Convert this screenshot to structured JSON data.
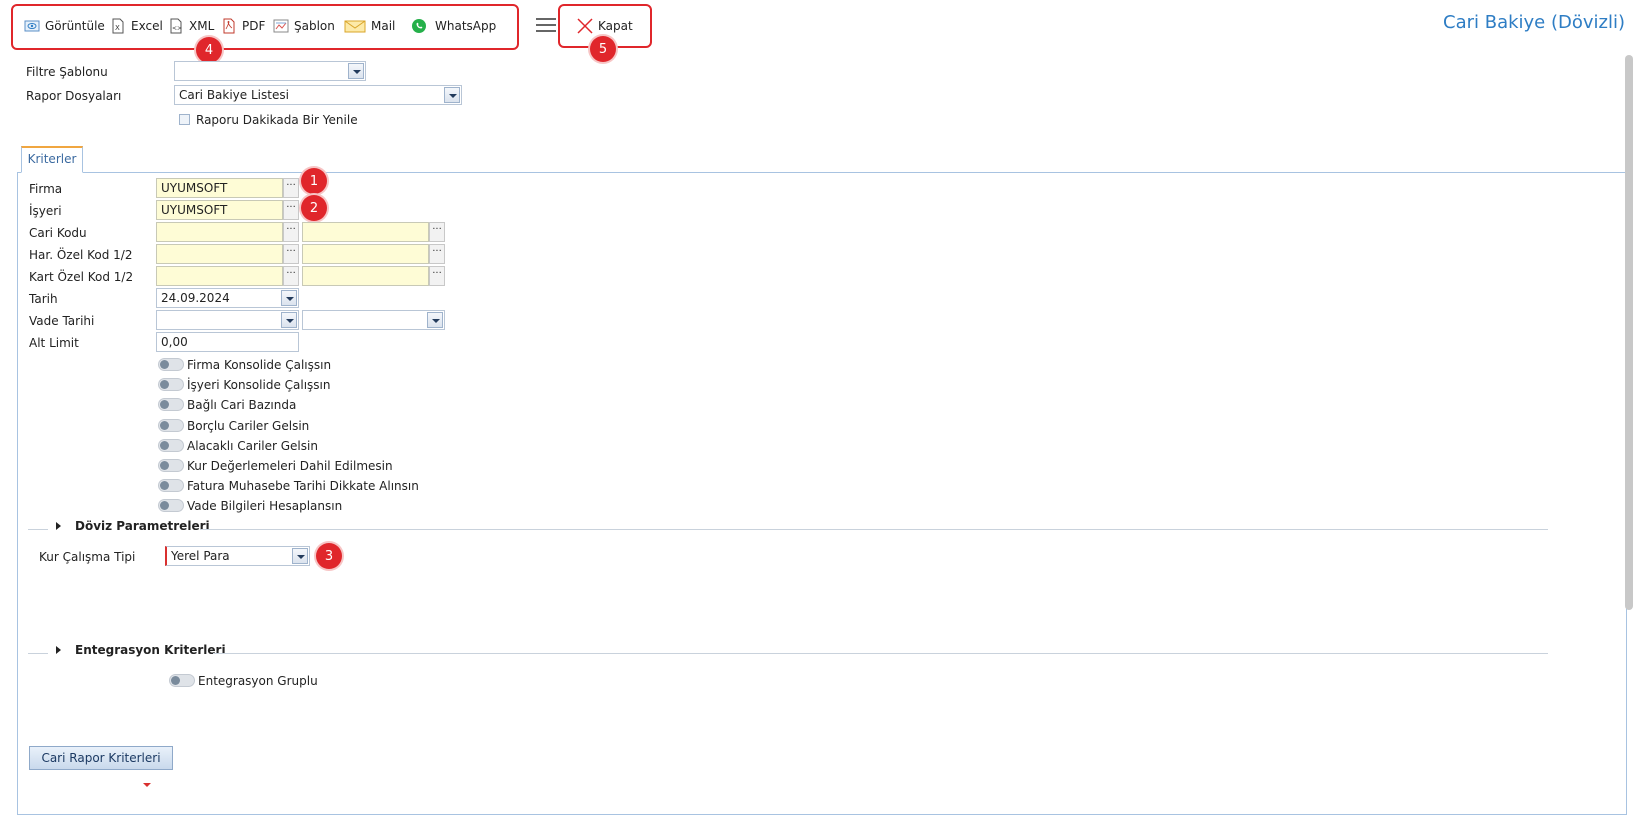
{
  "toolbar": {
    "items": [
      {
        "label": "Görüntüle",
        "icon": "view-icon"
      },
      {
        "label": "Excel",
        "icon": "excel-icon"
      },
      {
        "label": "XML",
        "icon": "xml-icon"
      },
      {
        "label": "PDF",
        "icon": "pdf-icon"
      },
      {
        "label": "Şablon",
        "icon": "template-icon"
      },
      {
        "label": "Mail",
        "icon": "mail-icon"
      },
      {
        "label": "WhatsApp",
        "icon": "whatsapp-icon"
      }
    ],
    "close_label": "Kapat",
    "menu_icon": "hamburger-icon"
  },
  "page_title": "Cari Bakiye (Dövizli)",
  "filters": {
    "filter_template_label": "Filtre Şablonu",
    "filter_template_value": "",
    "report_files_label": "Rapor Dosyaları",
    "report_files_value": "Cari Bakiye Listesi",
    "refresh_label": "Raporu Dakikada Bir Yenile"
  },
  "tab_label": "Kriterler",
  "criteria": {
    "firma_label": "Firma",
    "firma_value": "UYUMSOFT",
    "isyeri_label": "İşyeri",
    "isyeri_value": "UYUMSOFT",
    "cari_kodu_label": "Cari Kodu",
    "har_ozel_kod_label": "Har. Özel Kod 1/2",
    "kart_ozel_kod_label": "Kart Özel Kod 1/2",
    "tarih_label": "Tarih",
    "tarih_value": "24.09.2024",
    "vade_tarihi_label": "Vade Tarihi",
    "alt_limit_label": "Alt Limit",
    "alt_limit_value": "0,00"
  },
  "toggles": [
    "Firma Konsolide Çalışsın",
    "İşyeri Konsolide Çalışsın",
    "Bağlı Cari Bazında",
    "Borçlu Cariler Gelsin",
    "Alacaklı Cariler Gelsin",
    "Kur Değerlemeleri Dahil Edilmesin",
    "Fatura Muhasebe Tarihi Dikkate Alınsın",
    "Vade Bilgileri Hesaplansın"
  ],
  "doviz": {
    "section_title": "Döviz Parametreleri",
    "kur_label": "Kur Çalışma Tipi",
    "kur_value": "Yerel Para"
  },
  "entegrasyon": {
    "section_title": "Entegrasyon Kriterleri",
    "toggle_label": "Entegrasyon Gruplu"
  },
  "bottom_button": "Cari Rapor Kriterleri",
  "annotations": [
    "1",
    "2",
    "3",
    "4",
    "5"
  ],
  "colors": {
    "accent": "#2e7dc4",
    "annotation": "#e0262b",
    "field_yellow": "#fefcd6"
  }
}
